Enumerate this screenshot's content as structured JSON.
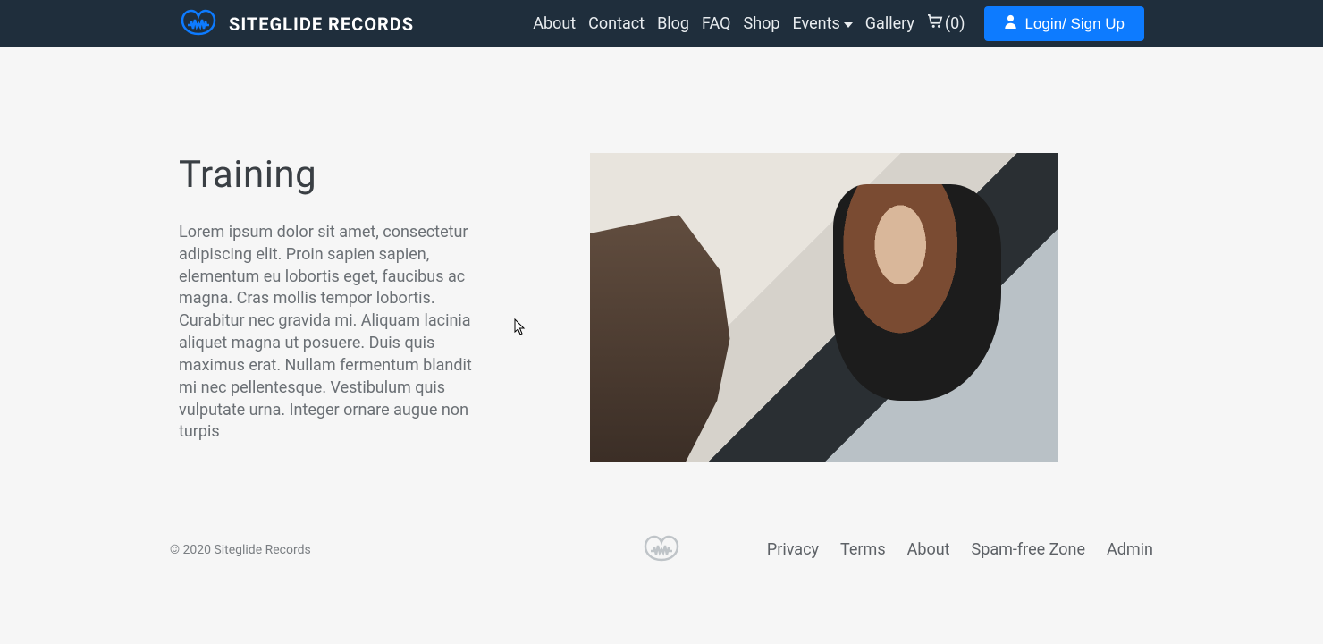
{
  "header": {
    "brand": "SITEGLIDE RECORDS",
    "nav": {
      "about": "About",
      "contact": "Contact",
      "blog": "Blog",
      "faq": "FAQ",
      "shop": "Shop",
      "events": "Events",
      "gallery": "Gallery"
    },
    "cart_count": "(0)",
    "login_label": "Login/ Sign Up"
  },
  "main": {
    "title": "Training",
    "body": "Lorem ipsum dolor sit amet, consectetur adipiscing elit. Proin sapien sapien, elementum eu lobortis eget, faucibus ac magna. Cras mollis tempor lobortis. Curabitur nec gravida mi. Aliquam lacinia aliquet magna ut posuere. Duis quis maximus erat. Nullam fermentum blandit mi nec pellentesque. Vestibulum quis vulputate urna. Integer ornare augue non turpis"
  },
  "footer": {
    "copyright": "© 2020 Siteglide Records",
    "links": {
      "privacy": "Privacy",
      "terms": "Terms",
      "about": "About",
      "spam": "Spam-free Zone",
      "admin": "Admin"
    }
  }
}
